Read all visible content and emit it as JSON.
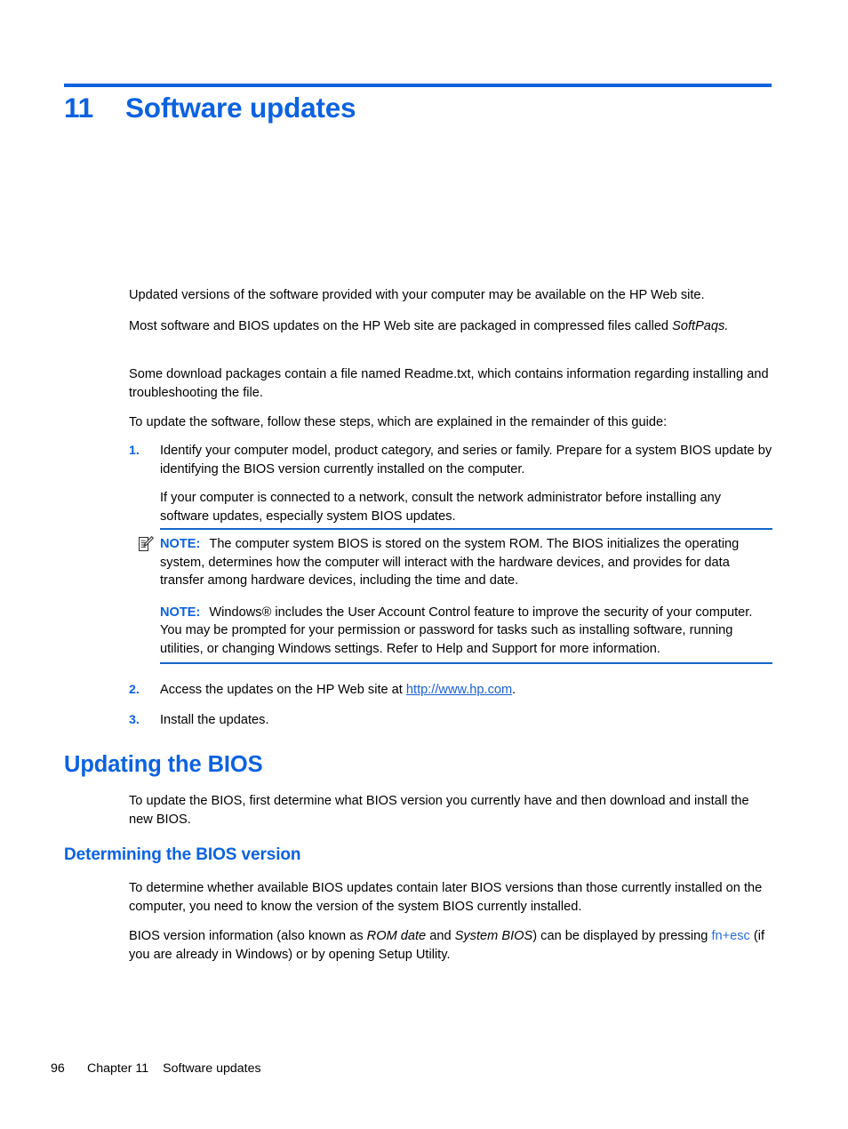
{
  "document": {
    "chapter_number": "11",
    "chapter_title": "Software updates"
  },
  "intro": {
    "p1": "Updated versions of the software provided with your computer may be available on the HP Web site.",
    "p2_before": "Most software and BIOS updates on the HP Web site are packaged in compressed files called ",
    "p2_italic": "SoftPaqs.",
    "p3": "Some download packages contain a file named Readme.txt, which contains information regarding installing and troubleshooting the file.",
    "p4": "To update the software, follow these steps, which are explained in the remainder of this guide:"
  },
  "steps": [
    {
      "number": "1.",
      "text": "Identify your computer model, product category, and series or family. Prepare for a system BIOS update by identifying the BIOS version currently installed on the computer.",
      "continuation": "If your computer is connected to a network, consult the network administrator before installing any software updates, especially system BIOS updates."
    },
    {
      "number": "2.",
      "text_before": "Access the updates on the HP Web site at ",
      "link_text": "http://www.hp.com",
      "text_after": "."
    },
    {
      "number": "3.",
      "text": "Install the updates."
    }
  ],
  "notes": {
    "icon_name": "note-pencil-icon",
    "label": "NOTE:",
    "note1": "The computer system BIOS is stored on the system ROM. The BIOS initializes the operating system, determines how the computer will interact with the hardware devices, and provides for data transfer among hardware devices, including the time and date.",
    "note2": "Windows® includes the User Account Control feature to improve the security of your computer. You may be prompted for your permission or password for tasks such as installing software, running utilities, or changing Windows settings. Refer to Help and Support for more information."
  },
  "sections": {
    "updating_bios": {
      "heading": "Updating the BIOS",
      "body": "To update the BIOS, first determine what BIOS version you currently have and then download and install the new BIOS."
    },
    "determining_version": {
      "heading": "Determining the BIOS version",
      "p1": "To determine whether available BIOS updates contain later BIOS versions than those currently installed on the computer, you need to know the version of the system BIOS currently installed.",
      "p2_a": "BIOS version information (also known as ",
      "p2_italic1": "ROM date",
      "p2_b": " and ",
      "p2_italic2": "System BIOS",
      "p2_c": ") can be displayed by pressing ",
      "p2_key": "fn+esc",
      "p2_d": " (if you are already in Windows) or by opening Setup Utility."
    }
  },
  "footer": {
    "page_number": "96",
    "chapter_label": "Chapter 11",
    "chapter_name": "Software updates"
  },
  "colors": {
    "accent_blue": "#0c62e0",
    "rule_blue": "#1466c8",
    "link_blue": "#1a5fd0"
  }
}
